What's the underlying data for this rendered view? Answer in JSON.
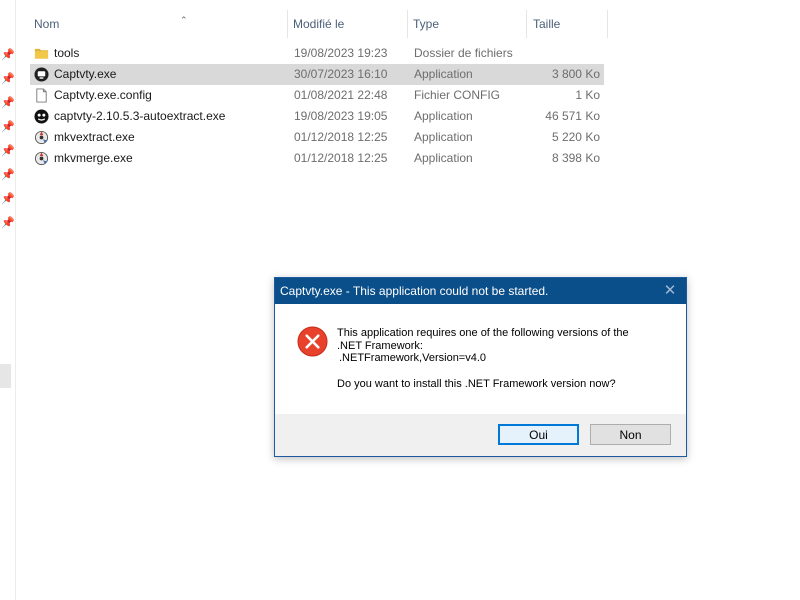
{
  "columns": {
    "name": "Nom",
    "modified": "Modifié le",
    "type": "Type",
    "size": "Taille"
  },
  "files": [
    {
      "name": "tools",
      "modified": "19/08/2023 19:23",
      "type": "Dossier de fichiers",
      "size": "",
      "icon": "folder-icon"
    },
    {
      "name": "Captvty.exe",
      "modified": "30/07/2023 16:10",
      "type": "Application",
      "size": "3 800 Ko",
      "icon": "captvty-app-icon",
      "selected": true
    },
    {
      "name": "Captvty.exe.config",
      "modified": "01/08/2021 22:48",
      "type": "Fichier CONFIG",
      "size": "1 Ko",
      "icon": "document-icon"
    },
    {
      "name": "captvty-2.10.5.3-autoextract.exe",
      "modified": "19/08/2023 19:05",
      "type": "Application",
      "size": "46 571 Ko",
      "icon": "installer-icon"
    },
    {
      "name": "mkvextract.exe",
      "modified": "01/12/2018 12:25",
      "type": "Application",
      "size": "5 220 Ko",
      "icon": "mkvtoolnix-icon"
    },
    {
      "name": "mkvmerge.exe",
      "modified": "01/12/2018 12:25",
      "type": "Application",
      "size": "8 398 Ko",
      "icon": "mkvtoolnix-icon"
    }
  ],
  "dialog": {
    "title": "Captvty.exe - This application could not be started.",
    "close": "✕",
    "line1": "This application requires one of the following versions of the",
    "line2": ".NET Framework:",
    "line3": ".NETFramework,Version=v4.0",
    "question": "Do you want to install this .NET Framework version now?",
    "yes_label": "Oui",
    "no_label": "Non",
    "icon": "error-icon"
  },
  "colors": {
    "title_bar": "#0b4f8a",
    "selection": "#d9d9d9",
    "error_red": "#e8412c",
    "folder": "#f2c84b"
  }
}
